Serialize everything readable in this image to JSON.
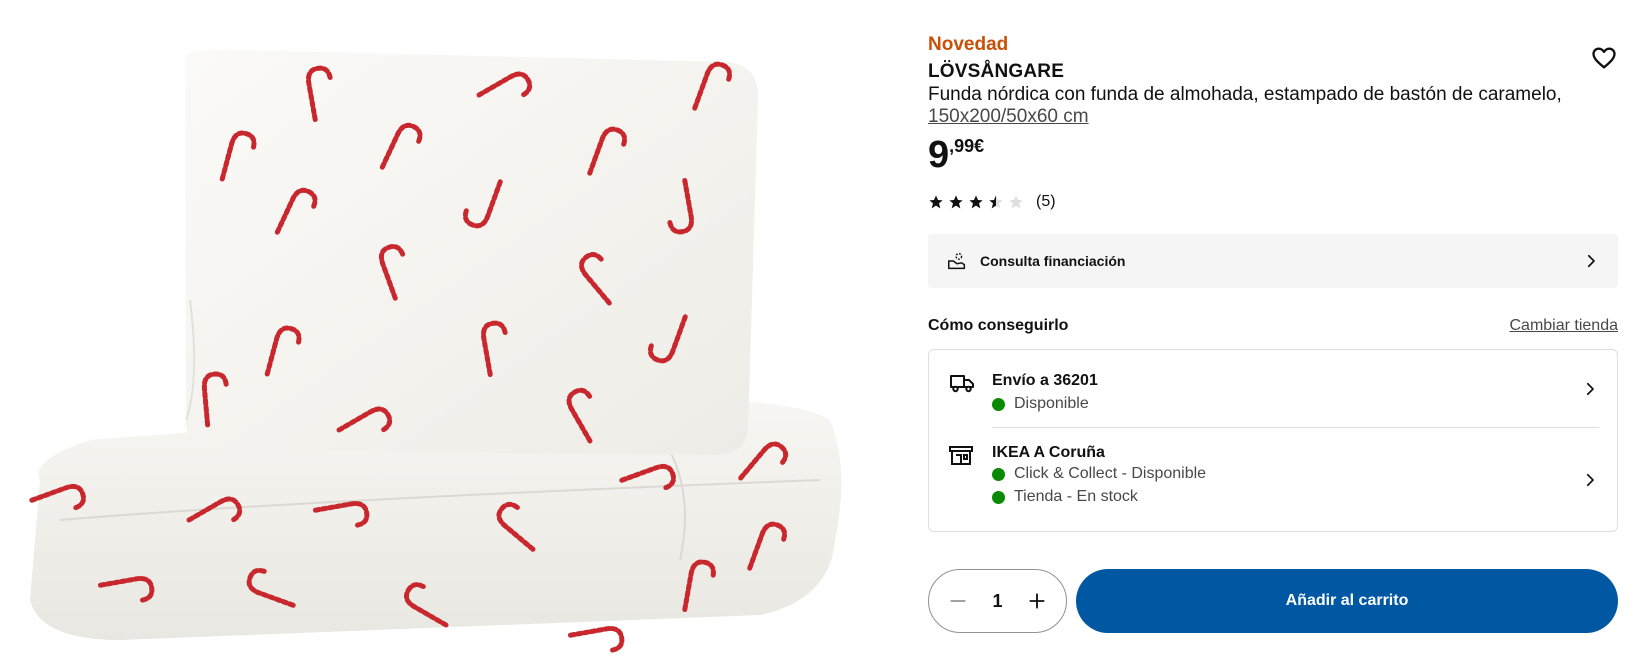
{
  "product": {
    "badge": "Novedad",
    "name": "LÖVSÅNGARE",
    "description": "Funda nórdica con funda de almohada, estampado de bastón de caramelo,",
    "size": "150x200/50x60 cm",
    "price_integer": "9",
    "price_decimal": ",99",
    "price_currency": "€",
    "rating": 3.5,
    "rating_count": "(5)"
  },
  "finance": {
    "label": "Consulta financiación",
    "icon": "coins-hand-icon"
  },
  "availability": {
    "title": "Cómo conseguirlo",
    "change_store": "Cambiar tienda",
    "delivery": {
      "title": "Envío a 36201",
      "status": "Disponible",
      "icon": "truck-icon"
    },
    "store": {
      "title": "IKEA A Coruña",
      "status_collect": "Click & Collect - Disponible",
      "status_stock": "Tienda - En stock",
      "icon": "store-icon"
    },
    "status_color": "#0a8a00"
  },
  "cart": {
    "quantity": "1",
    "add_label": "Añadir al carrito",
    "button_color": "#0058a3"
  },
  "colors": {
    "badge": "#ca5008",
    "accent": "#0058a3",
    "candy": "#c8272d"
  }
}
